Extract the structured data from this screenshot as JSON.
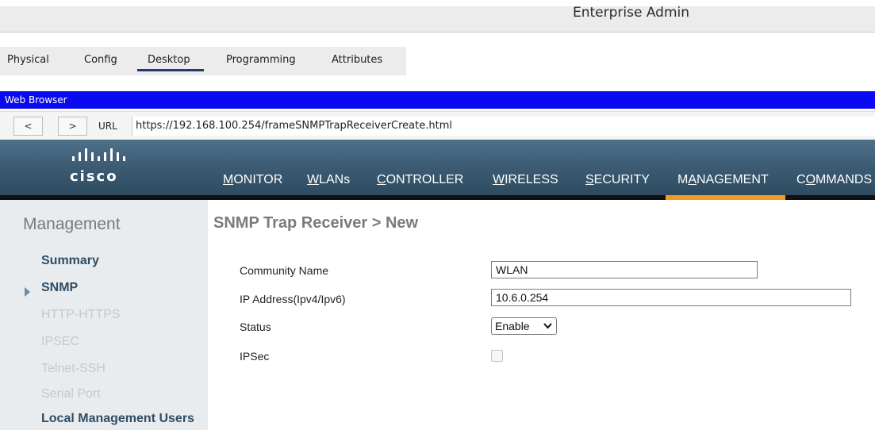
{
  "window": {
    "title": "Enterprise Admin"
  },
  "tabs": [
    {
      "label": "Physical"
    },
    {
      "label": "Config"
    },
    {
      "label": "Desktop",
      "active": true
    },
    {
      "label": "Programming"
    },
    {
      "label": "Attributes"
    }
  ],
  "browser": {
    "title": "Web Browser",
    "back_label": "<",
    "forward_label": ">",
    "url_label": "URL",
    "url": "https://192.168.100.254/frameSNMPTrapReceiverCreate.html"
  },
  "cisco": {
    "logo_text": "cisco",
    "brand_color": "#3d5d75",
    "accent_color": "#f29a26",
    "menu": [
      {
        "label": "MONITOR",
        "underline": "M",
        "rest": "ONITOR"
      },
      {
        "label": "WLANs",
        "underline": "W",
        "rest": "LANs"
      },
      {
        "label": "CONTROLLER",
        "underline": "C",
        "rest": "ONTROLLER"
      },
      {
        "label": "WIRELESS",
        "underline": "W",
        "rest": "IRELESS"
      },
      {
        "label": "SECURITY",
        "underline": "S",
        "rest": "ECURITY"
      },
      {
        "label": "MANAGEMENT",
        "pre": "M",
        "underline": "A",
        "rest": "NAGEMENT",
        "active": true
      },
      {
        "label": "COMMANDS",
        "pre": "C",
        "underline": "O",
        "rest": "MMANDS"
      }
    ]
  },
  "sidebar": {
    "title": "Management",
    "items": [
      {
        "label": "Summary",
        "state": "enabled"
      },
      {
        "label": "SNMP",
        "state": "selected"
      },
      {
        "label": "HTTP-HTTPS",
        "state": "disabled"
      },
      {
        "label": "IPSEC",
        "state": "disabled"
      },
      {
        "label": "Telnet-SSH",
        "state": "disabled"
      },
      {
        "label": "Serial Port",
        "state": "disabled"
      },
      {
        "label": "Local Management Users",
        "state": "enabled"
      }
    ]
  },
  "form": {
    "title": "SNMP Trap Receiver > New",
    "community_label": "Community Name",
    "community_value": "WLAN",
    "ip_label": "IP Address(Ipv4/Ipv6)",
    "ip_value": "10.6.0.254",
    "status_label": "Status",
    "status_value": "Enable",
    "ipsec_label": "IPSec",
    "ipsec_checked": false
  }
}
